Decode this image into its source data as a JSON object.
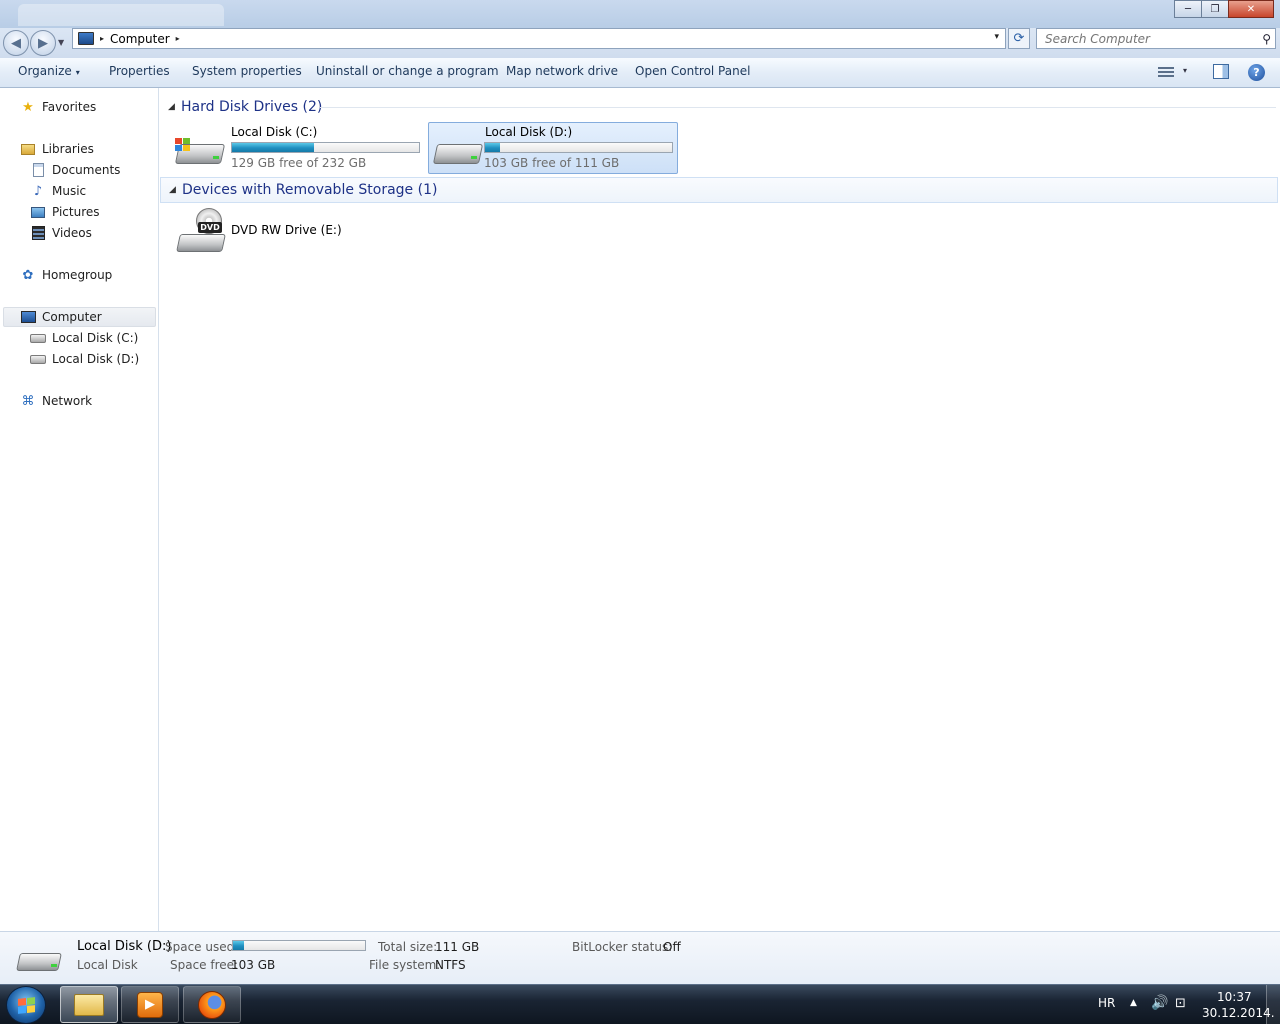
{
  "window": {
    "minimize": "─",
    "maximize": "❐",
    "close": "✕"
  },
  "address": {
    "segment": "Computer",
    "arrow": "▸",
    "dropdown": "▾",
    "refresh": "⟳"
  },
  "search": {
    "placeholder": "Search Computer",
    "icon": "⚲"
  },
  "toolbar": {
    "organize": "Organize",
    "organize_caret": "▾",
    "properties": "Properties",
    "system_properties": "System properties",
    "uninstall": "Uninstall or change a program",
    "map_drive": "Map network drive",
    "control_panel": "Open Control Panel",
    "view_caret": "▾",
    "help": "?"
  },
  "nav": {
    "favorites": "Favorites",
    "libraries": "Libraries",
    "documents": "Documents",
    "music": "Music",
    "pictures": "Pictures",
    "videos": "Videos",
    "homegroup": "Homegroup",
    "computer": "Computer",
    "disk_c": "Local Disk (C:)",
    "disk_d": "Local Disk (D:)",
    "network": "Network",
    "icons": {
      "star": "★",
      "music": "♪",
      "homegroup": "✿",
      "network": "⌘"
    }
  },
  "groups": {
    "hdd_title": "Hard Disk Drives (2)",
    "removable_title": "Devices with Removable Storage (1)",
    "collapse_glyph": "◢"
  },
  "drives": [
    {
      "name": "Local Disk (C:)",
      "free_text": "129 GB free of 232 GB",
      "used_fraction": 0.44
    },
    {
      "name": "Local Disk (D:)",
      "free_text": "103 GB free of 111 GB",
      "used_fraction": 0.08
    }
  ],
  "removable": {
    "name": "DVD RW Drive (E:)",
    "badge": "DVD"
  },
  "details": {
    "name": "Local Disk (D:)",
    "type": "Local Disk",
    "space_used_label": "Space used:",
    "space_used_fraction": 0.08,
    "space_free_label": "Space free:",
    "space_free_value": "103 GB",
    "total_size_label": "Total size:",
    "total_size_value": "111 GB",
    "filesystem_label": "File system:",
    "filesystem_value": "NTFS",
    "bitlocker_label": "BitLocker status:",
    "bitlocker_value": "Off"
  },
  "taskbar": {
    "language": "HR",
    "tray_up": "▲",
    "volume": "🔊",
    "network": "⊡",
    "media_glyph": "▶",
    "time": "10:37",
    "date": "30.12.2014."
  },
  "colors": {
    "accent": "#1e3287",
    "progress": "#1f8fc0",
    "selection": "#cde0f7"
  }
}
